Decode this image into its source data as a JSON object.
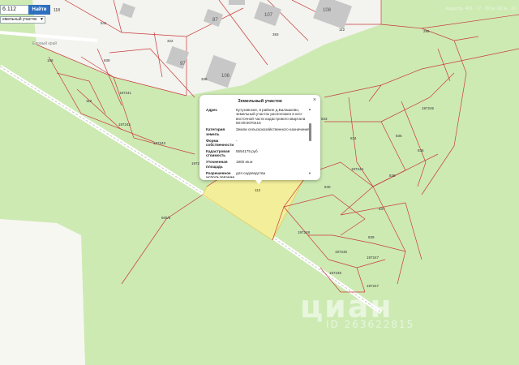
{
  "search": {
    "value": "6.112",
    "button_label": "Найти",
    "result_count": "118"
  },
  "type_select": {
    "value": "емельный участок"
  },
  "top_right_text": "Кадастр. 400 · 77 · 50 м ⁄ 82 м · 10",
  "map": {
    "road_label": "Еловый край",
    "houses": [
      "87",
      "107",
      "108",
      "97",
      "106"
    ],
    "parcels": [
      "541",
      "322",
      "393",
      "112",
      "296",
      "108",
      "839",
      "112",
      "197241",
      "197242",
      "197240",
      "197243",
      "325",
      "835",
      "197245",
      "836",
      "197244",
      "836",
      "197246",
      "197247",
      "197248",
      "837",
      "833",
      "834",
      "840",
      "839",
      "197246",
      "197247",
      "506/5",
      "112"
    ]
  },
  "popup": {
    "title": "Земельный участок",
    "rows": [
      {
        "key": "Адрес",
        "value": "Кутузовское, в районе д.Балашково, земельный участок расположен в юго-восточной части кадастрового квартала 50:09:0070416"
      },
      {
        "key": "Категория земель",
        "value": "Земли сельскохозяйственного назначения"
      },
      {
        "key": "Форма собственности",
        "value": "-"
      },
      {
        "key": "Кадастровая стоимость",
        "value": "5554175 руб"
      },
      {
        "key": "Уточненная площадь",
        "value": "1900 кв.м"
      },
      {
        "key": "Разрешенное использование",
        "value": "для садоводства"
      }
    ]
  },
  "watermark": {
    "text": "циан",
    "id": "ID 263622815"
  },
  "colors": {
    "grass": "#cdeab3",
    "forest": "#c4e3a6",
    "parcel_border": "#c83c3c",
    "highlight": "#f2ee9a",
    "road": "#ffffff",
    "button": "#2f6fbf"
  }
}
